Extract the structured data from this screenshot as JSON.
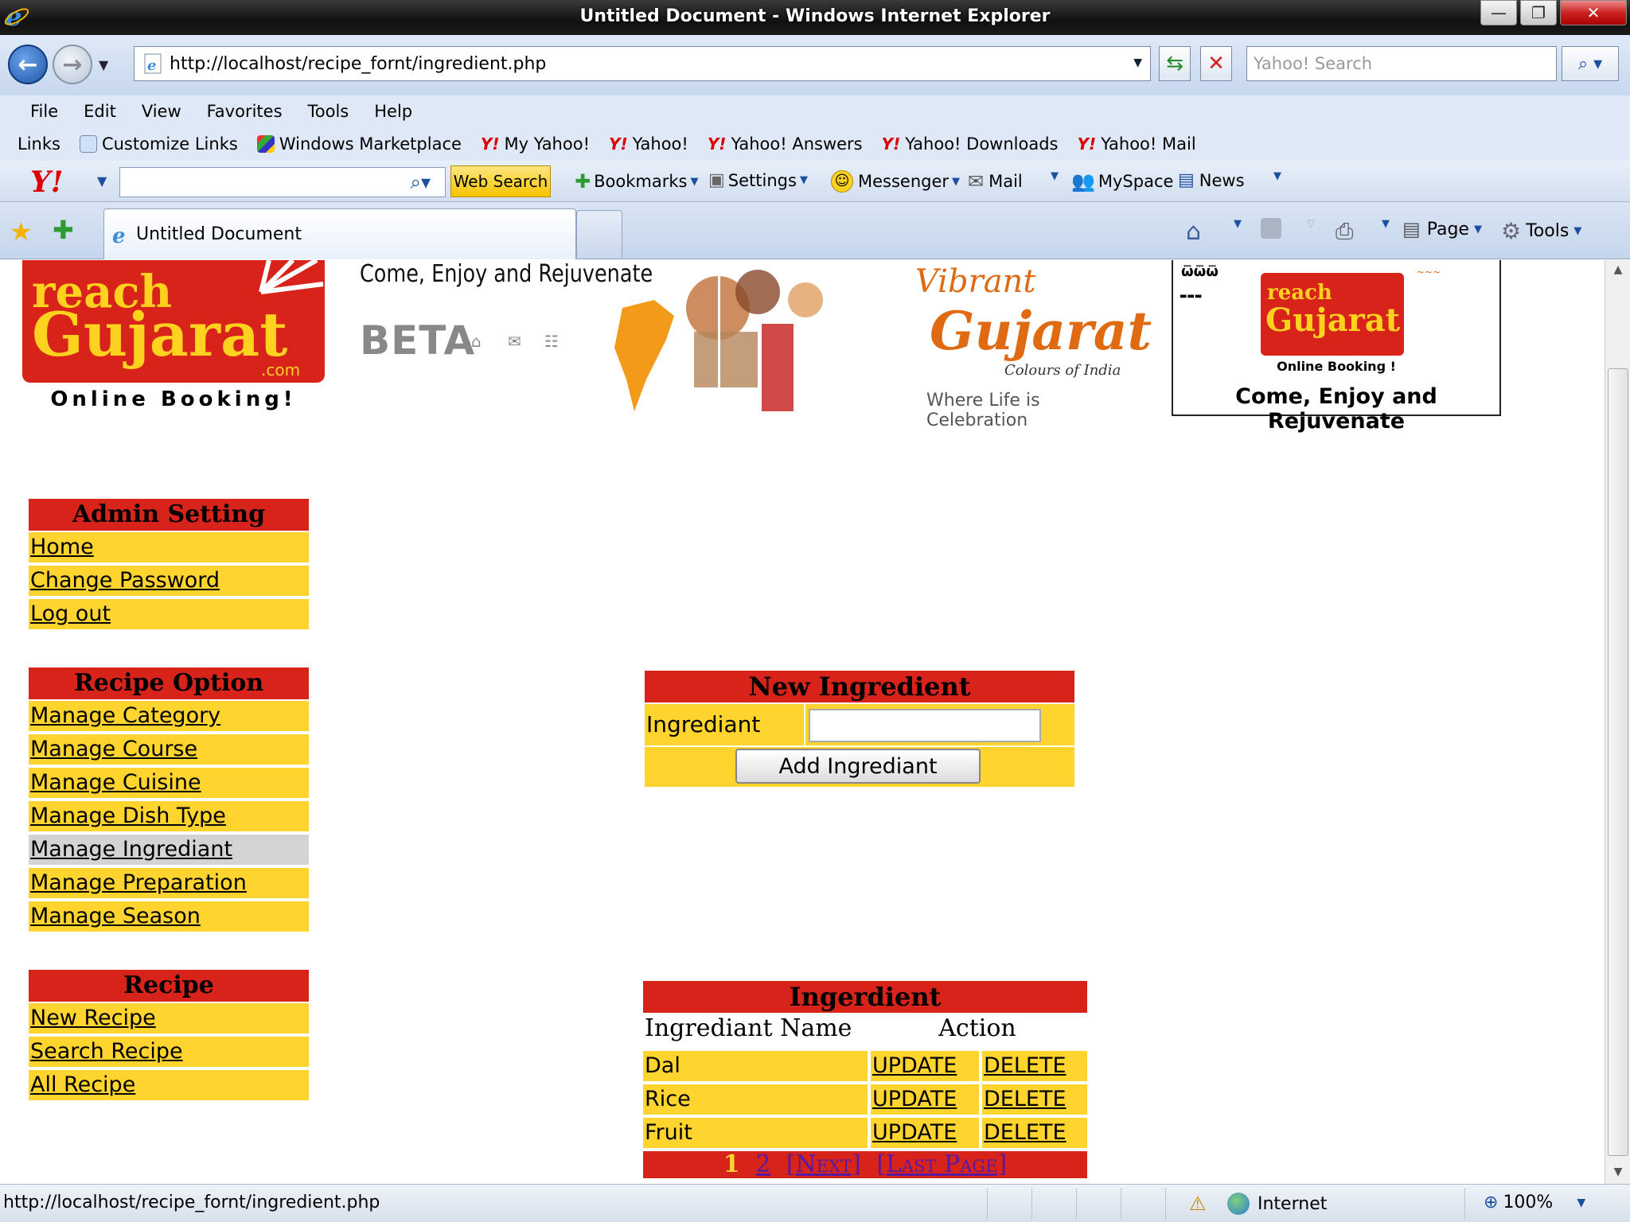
{
  "window": {
    "title": "Untitled Document - Windows Internet Explorer"
  },
  "navigation": {
    "address": "http://localhost/recipe_fornt/ingredient.php",
    "search_placeholder": "Yahoo! Search"
  },
  "menu": [
    "File",
    "Edit",
    "View",
    "Favorites",
    "Tools",
    "Help"
  ],
  "links_bar": {
    "label": "Links",
    "items": [
      "Customize Links",
      "Windows Marketplace",
      "My Yahoo!",
      "Yahoo!",
      "Yahoo! Answers",
      "Yahoo! Downloads",
      "Yahoo! Mail"
    ]
  },
  "yahoo_toolbar": {
    "logo": "Y!",
    "web_search": "Web Search",
    "bookmarks": "Bookmarks",
    "settings": "Settings",
    "messenger": "Messenger",
    "mail": "Mail",
    "myspace": "MySpace",
    "news": "News"
  },
  "tab": {
    "title": "Untitled Document"
  },
  "command_bar": {
    "page": "Page",
    "tools": "Tools"
  },
  "banner": {
    "logo_reach": "reach",
    "logo_gujarat": "Gujarat",
    "logo_com": ".com",
    "logo_online": "Online Booking!",
    "tagline": "Come, Enjoy and Rejuvenate",
    "beta": "BETA",
    "vibrant_1": "Vibrant",
    "vibrant_2": "Gujarat",
    "vibrant_3": "Colours of India",
    "vibrant_4": "Where Life is Celebration",
    "right_online": "Online Booking !",
    "right_tagline": "Come, Enjoy and Rejuvenate",
    "right_reach": "reach",
    "right_gujarat": "Gujarat"
  },
  "sidebar": {
    "admin": {
      "title": "Admin Setting",
      "items": [
        "Home",
        "Change Password",
        "Log out"
      ]
    },
    "recipe_option": {
      "title": "Recipe Option",
      "items": [
        "Manage Category",
        "Manage Course",
        "Manage Cuisine",
        "Manage Dish Type",
        "Manage Ingrediant",
        "Manage Preparation",
        "Manage Season"
      ],
      "active_item": "Manage Ingrediant"
    },
    "recipe": {
      "title": "Recipe",
      "items": [
        "New Recipe",
        "Search Recipe",
        "All Recipe"
      ]
    }
  },
  "new_ingredient": {
    "title": "New Ingredient",
    "label": "Ingrediant",
    "value": "",
    "button": "Add Ingrediant"
  },
  "ingredient_table": {
    "title": "Ingerdient",
    "col_name": "Ingrediant Name",
    "col_action": "Action",
    "rows": [
      {
        "name": "Dal",
        "update": "UPDATE",
        "delete": "DELETE"
      },
      {
        "name": "Rice",
        "update": "UPDATE",
        "delete": "DELETE"
      },
      {
        "name": "Fruit",
        "update": "UPDATE",
        "delete": "DELETE"
      }
    ],
    "pager": {
      "current": "1",
      "page2": "2",
      "next": "[Next]",
      "last": "[Last Page]"
    }
  },
  "status": {
    "url": "http://localhost/recipe_fornt/ingredient.php",
    "zone": "Internet",
    "zoom": "100%"
  },
  "colors": {
    "red": "#d8231b",
    "yellow": "#ffd42e",
    "active_gray": "#d4d4d4"
  }
}
